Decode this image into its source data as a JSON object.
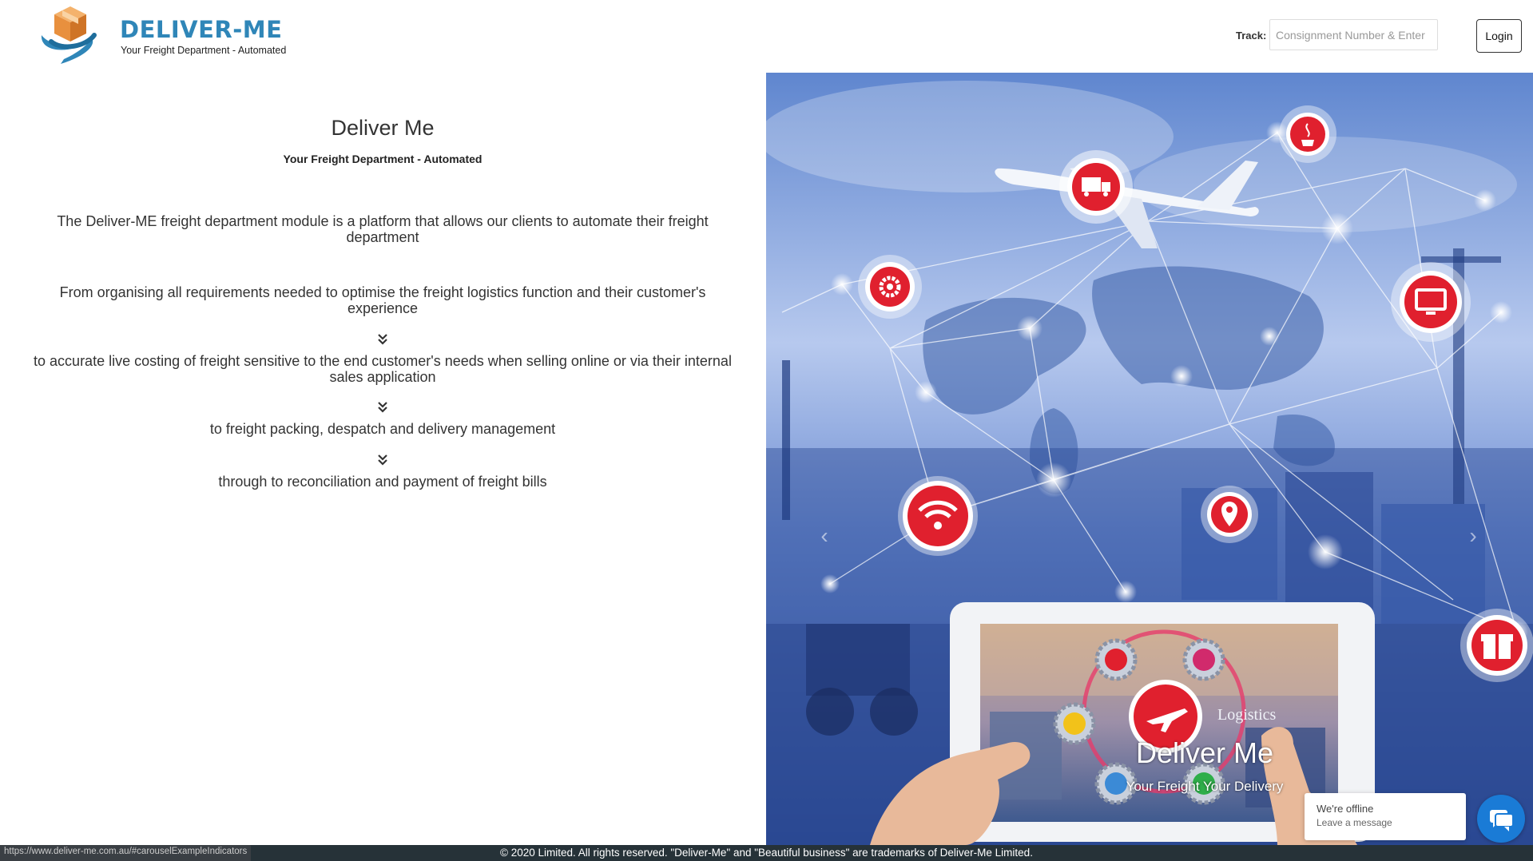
{
  "brand": {
    "name": "DELIVER-ME",
    "tagline": "Your Freight Department - Automated"
  },
  "header": {
    "track_label": "Track:",
    "track_placeholder": "Consignment Number & Enter",
    "login_label": "Login"
  },
  "main": {
    "title": "Deliver Me",
    "subtitle": "Your Freight Department - Automated",
    "paragraphs": [
      "The Deliver-ME freight department module is a platform that allows our clients to automate their freight department",
      "From organising all requirements needed to optimise the freight logistics function and their customer's experience",
      "to accurate live costing of freight sensitive to the end customer's needs when selling online or via their internal sales application",
      "to freight packing, despatch and delivery management",
      "through to reconciliation and payment of freight bills"
    ]
  },
  "carousel": {
    "tablet_title": "Deliver Me",
    "tablet_subtitle": "Your Freight Your Delivery",
    "tablet_word": "Logistics",
    "indicator_count": 3,
    "active_index": 2,
    "icons": [
      "truck-icon",
      "java-icon",
      "gear-icon",
      "monitor-icon",
      "wifi-icon",
      "location-pin-icon",
      "gift-icon"
    ]
  },
  "chat": {
    "status": "We're offline",
    "action": "Leave a message"
  },
  "footer": {
    "text": "© 2020 Limited. All rights reserved. \"Deliver-Me\" and \"Beautiful business\" are trademarks of Deliver-Me Limited."
  },
  "status_bar": {
    "url": "https://www.deliver-me.com.au/#carouselExampleIndicators"
  },
  "colors": {
    "brand_blue": "#2f86b8",
    "box_orange": "#e8903e",
    "accent_red": "#e0202e",
    "footer_bg": "#263238",
    "chat_blue": "#1a7bd6"
  }
}
